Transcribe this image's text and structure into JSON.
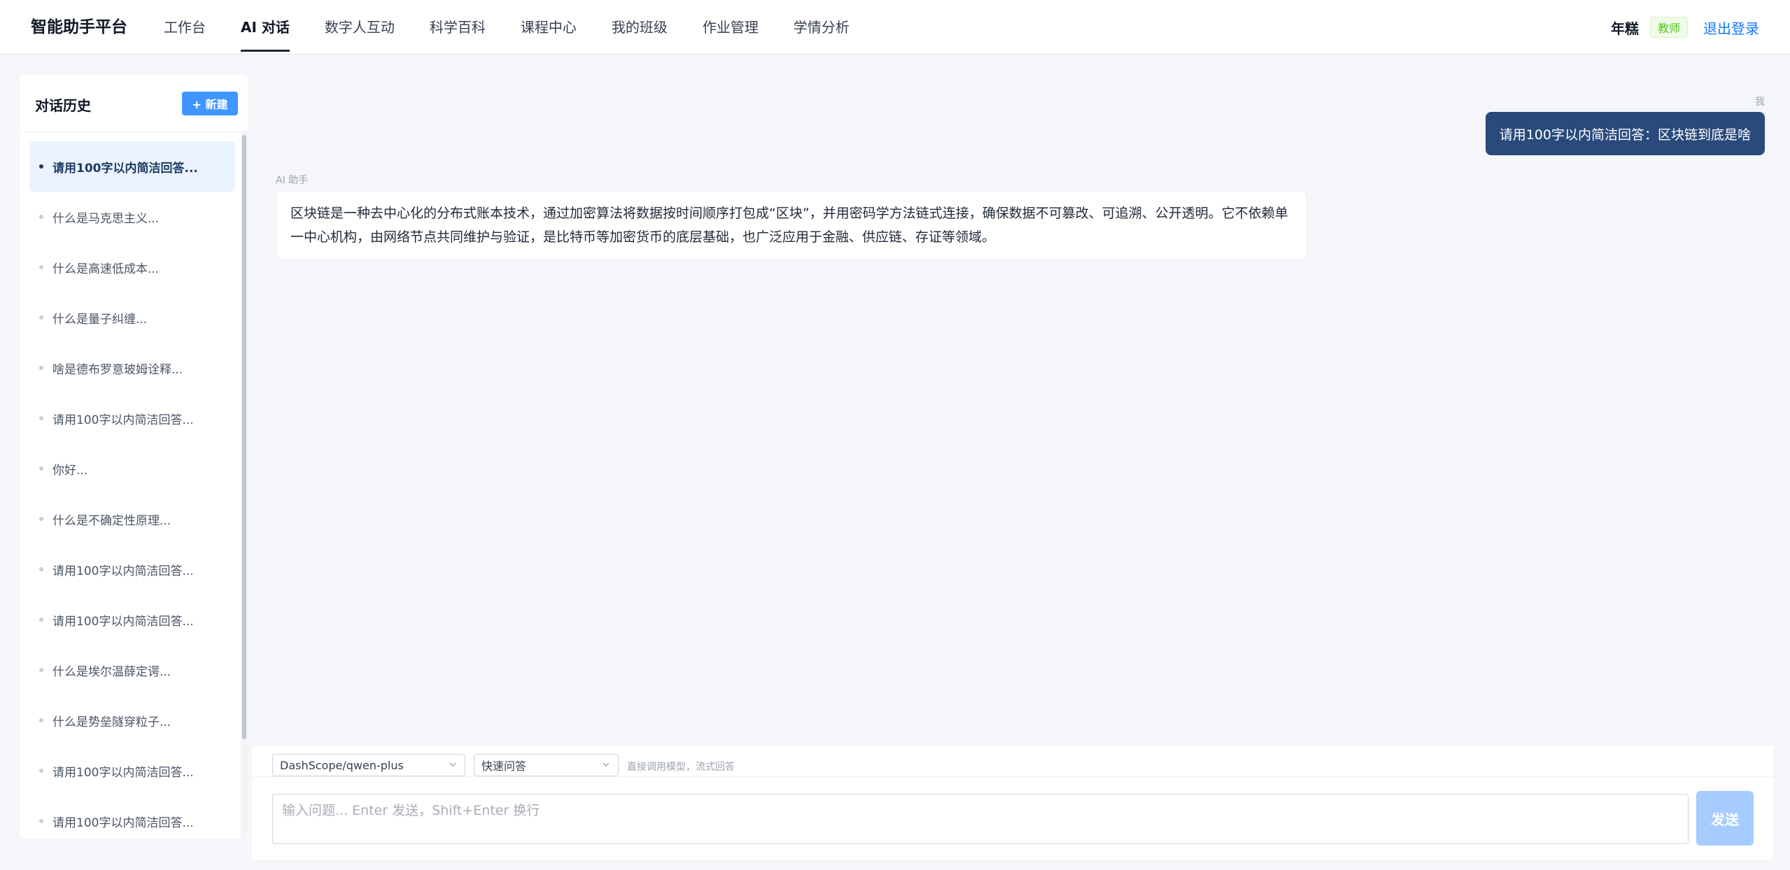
{
  "header": {
    "brand": "智能助手平台",
    "nav": [
      {
        "label": "工作台",
        "active": false
      },
      {
        "label": "AI 对话",
        "active": true
      },
      {
        "label": "数字人互动",
        "active": false
      },
      {
        "label": "科学百科",
        "active": false
      },
      {
        "label": "课程中心",
        "active": false
      },
      {
        "label": "我的班级",
        "active": false
      },
      {
        "label": "作业管理",
        "active": false
      },
      {
        "label": "学情分析",
        "active": false
      }
    ],
    "user_name": "年糕",
    "role_badge": "教师",
    "logout_label": "退出登录"
  },
  "sidebar": {
    "title": "对话历史",
    "new_button_label": "+ 新建",
    "items": [
      {
        "label": "请用100字以内简洁回答...",
        "active": true
      },
      {
        "label": "什么是马克思主义...",
        "active": false
      },
      {
        "label": "什么是高速低成本...",
        "active": false
      },
      {
        "label": "什么是量子纠缠...",
        "active": false
      },
      {
        "label": "啥是德布罗意玻姆诠释...",
        "active": false
      },
      {
        "label": "请用100字以内简洁回答...",
        "active": false
      },
      {
        "label": "你好...",
        "active": false
      },
      {
        "label": "什么是不确定性原理...",
        "active": false
      },
      {
        "label": "请用100字以内简洁回答...",
        "active": false
      },
      {
        "label": "请用100字以内简洁回答...",
        "active": false
      },
      {
        "label": "什么是埃尔温薛定谔...",
        "active": false
      },
      {
        "label": "什么是势垒隧穿粒子...",
        "active": false
      },
      {
        "label": "请用100字以内简洁回答...",
        "active": false
      },
      {
        "label": "请用100字以内简洁回答...",
        "active": false
      }
    ]
  },
  "chat": {
    "user_label": "我",
    "user_message": "请用100字以内简洁回答：区块链到底是啥",
    "ai_label": "AI 助手",
    "ai_message": "区块链是一种去中心化的分布式账本技术，通过加密算法将数据按时间顺序打包成“区块”，并用密码学方法链式连接，确保数据不可篡改、可追溯、公开透明。它不依赖单一中心机构，由网络节点共同维护与验证，是比特币等加密货币的底层基础，也广泛应用于金融、供应链、存证等领域。"
  },
  "composer": {
    "model_select_value": "DashScope/qwen-plus",
    "mode_select_value": "快速问答",
    "hint": "直接调用模型，流式回答",
    "input_placeholder": "输入问题... Enter 发送，Shift+Enter 换行",
    "send_label": "发送"
  },
  "colors": {
    "accent": "#1677ff",
    "new_button": "#4096ff",
    "user_bubble": "#2a4a7b",
    "send_button_disabled": "#a6cbff",
    "role_badge_text": "#52c41a"
  }
}
